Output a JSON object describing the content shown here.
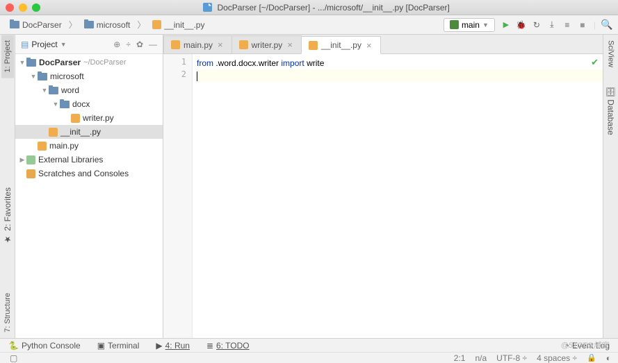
{
  "window": {
    "title": "DocParser [~/DocParser] - .../microsoft/__init__.py [DocParser]"
  },
  "breadcrumbs": [
    "DocParser",
    "microsoft",
    "__init__.py"
  ],
  "run_config": {
    "label": "main"
  },
  "left_tabs": [
    "1: Project",
    "2: Favorites",
    "7: Structure"
  ],
  "right_tabs": [
    "SciView",
    "Database"
  ],
  "project_panel": {
    "title": "Project",
    "items": [
      {
        "label": "DocParser",
        "extra": "~/DocParser",
        "type": "root",
        "depth": 0,
        "arrow": "▼",
        "selected": false
      },
      {
        "label": "microsoft",
        "type": "folder",
        "depth": 1,
        "arrow": "▼",
        "selected": false
      },
      {
        "label": "word",
        "type": "folder",
        "depth": 2,
        "arrow": "▼",
        "selected": false
      },
      {
        "label": "docx",
        "type": "folder",
        "depth": 3,
        "arrow": "▼",
        "selected": false
      },
      {
        "label": "writer.py",
        "type": "py",
        "depth": 4,
        "arrow": "",
        "selected": false
      },
      {
        "label": "__init__.py",
        "type": "py",
        "depth": 2,
        "arrow": "",
        "selected": true
      },
      {
        "label": "main.py",
        "type": "py",
        "depth": 1,
        "arrow": "",
        "selected": false
      },
      {
        "label": "External Libraries",
        "type": "lib",
        "depth": 0,
        "arrow": "▶",
        "selected": false
      },
      {
        "label": "Scratches and Consoles",
        "type": "scratch",
        "depth": 0,
        "arrow": "",
        "selected": false
      }
    ]
  },
  "editor": {
    "tabs": [
      {
        "label": "main.py",
        "active": false
      },
      {
        "label": "writer.py",
        "active": false
      },
      {
        "label": "__init__.py",
        "active": true
      }
    ],
    "lines": [
      "1",
      "2"
    ],
    "code": {
      "kw_from": "from",
      "module": ".word.docx.writer",
      "kw_import": "import",
      "ident": "write"
    }
  },
  "bottom": {
    "python_console": "Python Console",
    "terminal": "Terminal",
    "run": "4: Run",
    "todo": "6: TODO",
    "event_log": "Event Log"
  },
  "status": {
    "pos": "2:1",
    "na": "n/a",
    "encoding": "UTF-8",
    "indent": "4 spaces"
  },
  "watermark": "@51CTO博客"
}
